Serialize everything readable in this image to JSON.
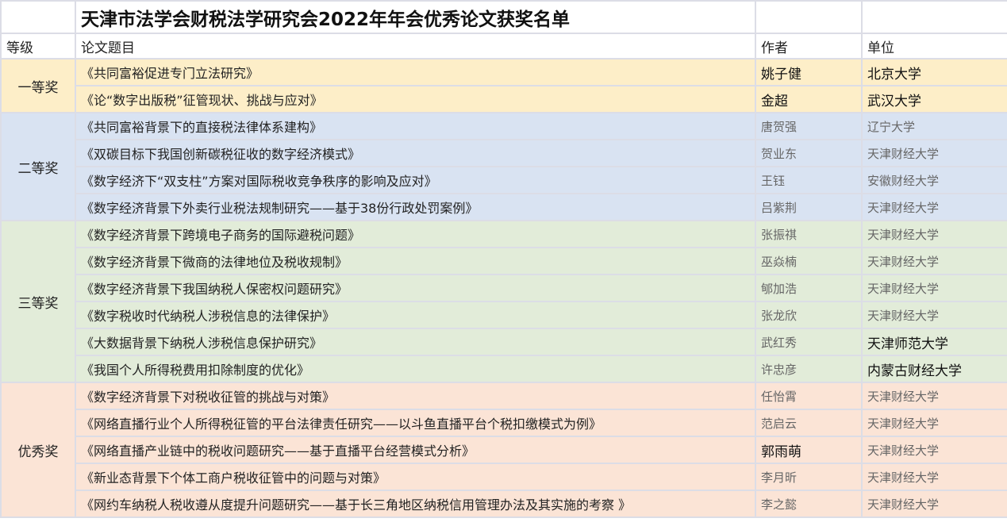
{
  "title": "天津市法学会财税法学研究会2022年年会优秀论文获奖名单",
  "headers": {
    "level": "等级",
    "paper": "论文题目",
    "author": "作者",
    "unit": "单位"
  },
  "groups": [
    {
      "level": "一等奖",
      "rows": [
        {
          "paper": "《共同富裕促进专门立法研究》",
          "author": "姚子健",
          "unit": "北京大学"
        },
        {
          "paper": "《论“数字出版税”征管现状、挑战与应对》",
          "author": "金超",
          "unit": "武汉大学"
        }
      ]
    },
    {
      "level": "二等奖",
      "rows": [
        {
          "paper": "《共同富裕背景下的直接税法律体系建构》",
          "author": "唐贺强",
          "unit": "辽宁大学"
        },
        {
          "paper": "《双碳目标下我国创新碳税征收的数字经济模式》",
          "author": "贺业东",
          "unit": "天津财经大学"
        },
        {
          "paper": "《数字经济下“双支柱”方案对国际税收竞争秩序的影响及应对》",
          "author": "王钰",
          "unit": "安徽财经大学"
        },
        {
          "paper": "《数字经济背景下外卖行业税法规制研究——基于38份行政处罚案例》",
          "author": "吕紫荆",
          "unit": "天津财经大学"
        }
      ]
    },
    {
      "level": "三等奖",
      "rows": [
        {
          "paper": "《数字经济背景下跨境电子商务的国际避税问题》",
          "author": "张振祺",
          "unit": "天津财经大学"
        },
        {
          "paper": "《数字经济背景下微商的法律地位及税收规制》",
          "author": "巫焱楠",
          "unit": "天津财经大学"
        },
        {
          "paper": "《数字经济背景下我国纳税人保密权问题研究》",
          "author": "郇加浩",
          "unit": "天津财经大学"
        },
        {
          "paper": "《数字税收时代纳税人涉税信息的法律保护》",
          "author": "张龙欣",
          "unit": "天津财经大学"
        },
        {
          "paper": "《大数据背景下纳税人涉税信息保护研究》",
          "author": "武红秀",
          "unit": "天津师范大学"
        },
        {
          "paper": "《我国个人所得税费用扣除制度的优化》",
          "author": "许忠彦",
          "unit": "内蒙古财经大学"
        }
      ]
    },
    {
      "level": "优秀奖",
      "rows": [
        {
          "paper": "《数字经济背景下对税收征管的挑战与对策》",
          "author": "任怡霄",
          "unit": "天津财经大学"
        },
        {
          "paper": "《网络直播行业个人所得税征管的平台法律责任研究——以斗鱼直播平台个税扣缴模式为例》",
          "author": "范启云",
          "unit": "天津财经大学"
        },
        {
          "paper": "《网络直播产业链中的税收问题研究——基于直播平台经营模式分析》",
          "author": "郭雨萌",
          "unit": "天津财经大学"
        },
        {
          "paper": "《新业态背景下个体工商户税收征管中的问题与对策》",
          "author": "李月昕",
          "unit": "天津财经大学"
        },
        {
          "paper": "《网约车纳税人税收遵从度提升问题研究——基于长三角地区纳税信用管理办法及其实施的考察 》",
          "author": "李之懿",
          "unit": "天津财经大学"
        }
      ]
    }
  ]
}
